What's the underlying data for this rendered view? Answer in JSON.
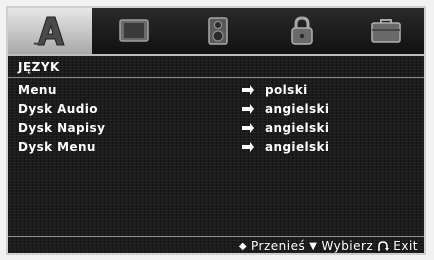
{
  "tabs": [
    {
      "icon": "language-a-icon",
      "active": true
    },
    {
      "icon": "tv-screen-icon",
      "active": false
    },
    {
      "icon": "speaker-icon",
      "active": false
    },
    {
      "icon": "padlock-icon",
      "active": false
    },
    {
      "icon": "briefcase-icon",
      "active": false
    }
  ],
  "section_title": "JĘZYK",
  "settings": [
    {
      "label": "Menu",
      "value": "polski"
    },
    {
      "label": "Dysk Audio",
      "value": "angielski"
    },
    {
      "label": "Dysk Napisy",
      "value": "angielski"
    },
    {
      "label": "Dysk Menu",
      "value": "angielski"
    }
  ],
  "footer": {
    "move_icon": "◆",
    "move_label": "Przenieś",
    "select_icon": "▼",
    "select_label": "Wybierz",
    "exit_icon": "return-icon",
    "exit_label": "Exit"
  },
  "colors": {
    "panel_background": "#1b1b1b",
    "text": "#ffffff",
    "active_tab": "#d6d6d6"
  }
}
